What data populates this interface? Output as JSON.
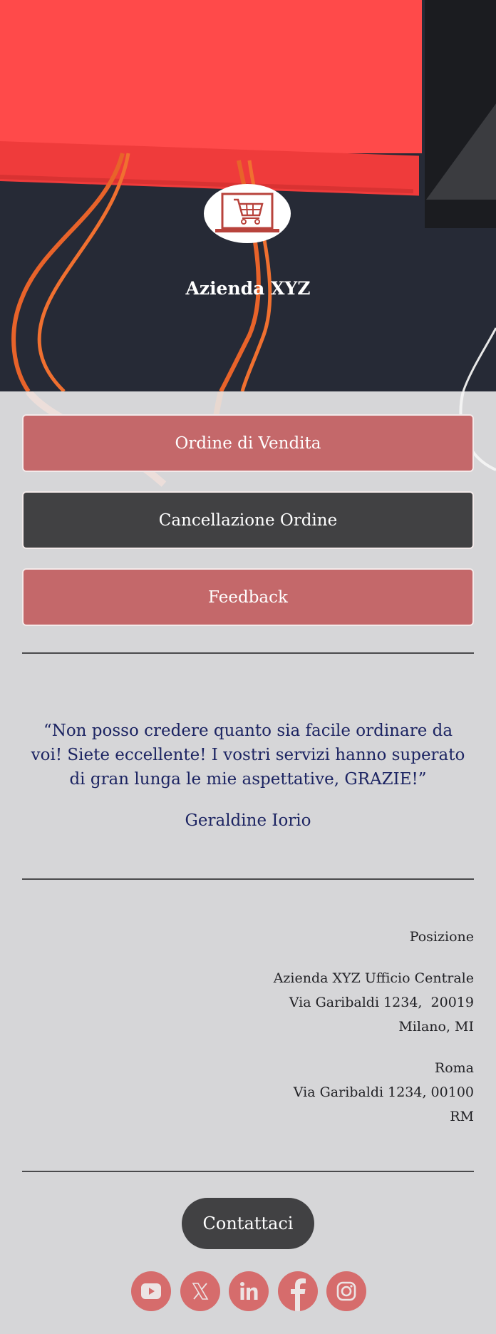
{
  "header": {
    "brand_title": "Azienda XYZ",
    "logo_icon": "shopping-cart-laptop-icon"
  },
  "actions": [
    {
      "label": "Ordine di Vendita",
      "variant": "red"
    },
    {
      "label": "Cancellazione Ordine",
      "variant": "dark"
    },
    {
      "label": "Feedback",
      "variant": "red"
    }
  ],
  "testimonial": {
    "quote": "“Non posso credere quanto sia facile ordinare da voi! Siete eccellente! I vostri servizi hanno superato di gran lunga le mie aspettative, GRAZIE!”",
    "author": "Geraldine Iorio"
  },
  "locations": {
    "heading": "Posizione",
    "offices": [
      {
        "lines": [
          "Azienda XYZ Ufficio Centrale",
          "Via Garibaldi 1234,  20019",
          "Milano, MI"
        ]
      },
      {
        "lines": [
          "Roma",
          "Via Garibaldi 1234, 00100",
          "RM"
        ]
      }
    ]
  },
  "footer": {
    "contact_label": "Contattaci",
    "socials": [
      {
        "name": "youtube",
        "icon": "youtube-icon"
      },
      {
        "name": "x",
        "icon": "x-twitter-icon"
      },
      {
        "name": "linkedin",
        "icon": "linkedin-icon"
      },
      {
        "name": "facebook",
        "icon": "facebook-icon"
      },
      {
        "name": "instagram",
        "icon": "instagram-icon"
      }
    ]
  },
  "colors": {
    "accent_red": "#c4686a",
    "dark": "#414143",
    "social_red": "#d66c6c",
    "testimonial_text": "#1c2462",
    "page_bg": "#d6d6d8"
  }
}
